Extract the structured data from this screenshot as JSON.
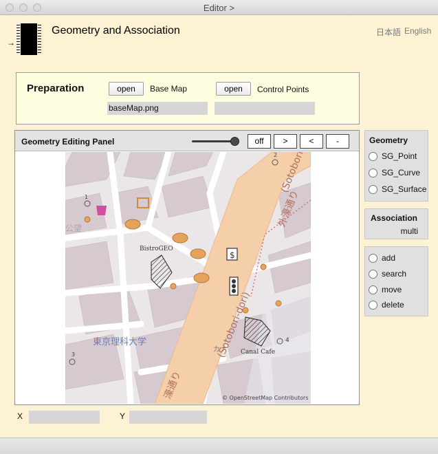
{
  "window": {
    "title": "Editor >"
  },
  "header": {
    "title": "Geometry and Association",
    "lang_ja": "日本語",
    "lang_en": "English"
  },
  "preparation": {
    "title": "Preparation",
    "base_map": {
      "button": "open",
      "label": "Base Map",
      "value": "baseMap.png"
    },
    "control_points": {
      "button": "open",
      "label": "Control Points",
      "value": ""
    }
  },
  "editing_panel": {
    "title": "Geometry Editing Panel",
    "slider_level": 1.0,
    "buttons": {
      "off": "off",
      "next": ">",
      "prev": "<",
      "minus": "-"
    }
  },
  "map": {
    "labels": {
      "street_jp": "外濠通り",
      "street_jp2": "(Sotobori-dori)",
      "street_en": "(Sotobori-dori)",
      "street_jp3": "濠通り",
      "street_jp4": "通り",
      "university": "東京理科大学",
      "kana": "カナ",
      "bistro": "BistroGEO",
      "canal": "Canal Cafe",
      "credit": "© OpenStreetMap Contributors",
      "num1": "1",
      "num2": "2",
      "num3": "3",
      "num4": "4",
      "fragment": "公望"
    },
    "colors": {
      "road_main": "#f5cfa9",
      "building": "#d5c9ce",
      "block": "#e8e4e6",
      "road": "#ffffff"
    }
  },
  "sidebar": {
    "geometry": {
      "title": "Geometry",
      "options": [
        "SG_Point",
        "SG_Curve",
        "SG_Surface"
      ]
    },
    "association": {
      "title": "Association",
      "value": "multi"
    },
    "actions": [
      "add",
      "search",
      "move",
      "delete"
    ]
  },
  "coords": {
    "x_label": "X",
    "x_value": "",
    "y_label": "Y",
    "y_value": ""
  }
}
